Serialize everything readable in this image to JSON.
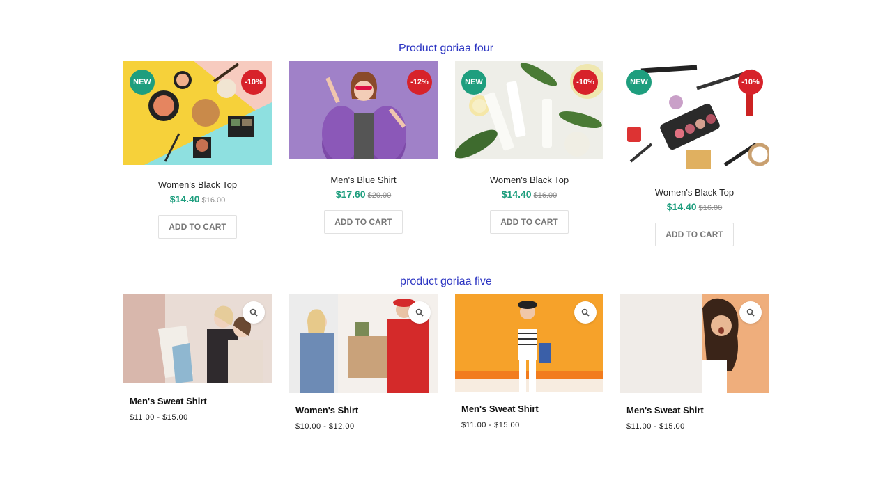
{
  "section_four": {
    "title": "Product goriaa four",
    "products": [
      {
        "name": "Women's Black Top",
        "badge_new": "NEW",
        "badge_sale": "-10%",
        "price": "$14.40",
        "old_price": "$16.00",
        "button": "ADD TO CART"
      },
      {
        "name": "Men's Blue Shirt",
        "badge_sale": "-12%",
        "price": "$17.60",
        "old_price": "$20.00",
        "button": "ADD TO CART"
      },
      {
        "name": "Women's Black Top",
        "badge_new": "NEW",
        "badge_sale": "-10%",
        "price": "$14.40",
        "old_price": "$16.00",
        "button": "ADD TO CART"
      },
      {
        "name": "Women's Black Top",
        "badge_new": "NEW",
        "badge_sale": "-10%",
        "price": "$14.40",
        "old_price": "$16.00",
        "button": "ADD TO CART"
      }
    ]
  },
  "section_five": {
    "title": "product goriaa five",
    "products": [
      {
        "name": "Men's Sweat Shirt",
        "price": "$11.00 - $15.00"
      },
      {
        "name": "Women's Shirt",
        "price": "$10.00 - $12.00"
      },
      {
        "name": "Men's Sweat Shirt",
        "price": "$11.00 - $15.00"
      },
      {
        "name": "Men's Sweat Shirt",
        "price": "$11.00 - $15.00"
      }
    ]
  },
  "colors": {
    "title": "#2b34c2",
    "new_badge": "#1e9e7e",
    "sale_badge": "#d7222a",
    "price": "#1e9e7e"
  },
  "icons": {
    "quick_view": "search-icon"
  }
}
